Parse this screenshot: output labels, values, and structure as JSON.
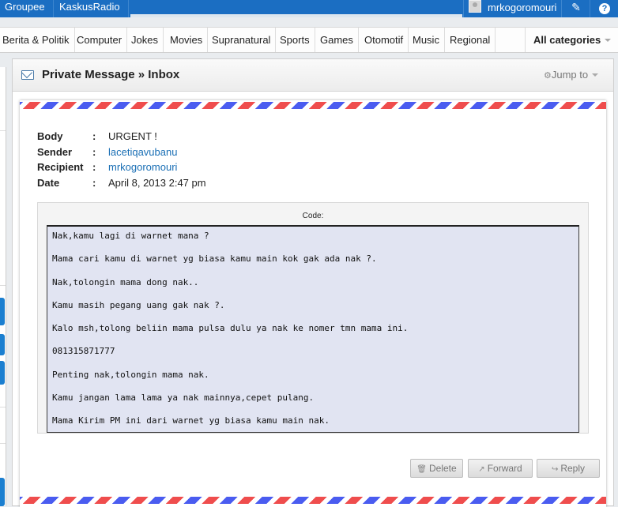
{
  "topbar": {
    "links": [
      "Groupee",
      "KaskusRadio"
    ],
    "username": "mrkogoromouri",
    "edit_icon": "pencil-icon",
    "help_label": "?"
  },
  "categories": {
    "items": [
      "Berita & Politik",
      "Computer",
      "Jokes",
      "Movies",
      "Supranatural",
      "Sports",
      "Games",
      "Otomotif",
      "Music",
      "Regional"
    ],
    "all_label": "All categories"
  },
  "panel": {
    "title": "Private Message » Inbox",
    "jump_label": "Jump to"
  },
  "message": {
    "fields": [
      {
        "label": "Body",
        "value": "URGENT !",
        "is_link": false
      },
      {
        "label": "Sender",
        "value": "lacetiqavubanu",
        "is_link": true
      },
      {
        "label": "Recipient",
        "value": "mrkogoromouri",
        "is_link": true
      },
      {
        "label": "Date",
        "value": "April 8, 2013 2:47 pm",
        "is_link": false
      }
    ],
    "separator": ":",
    "code_label": "Code:",
    "code_lines": [
      "Nak,kamu lagi di warnet mana ?",
      "Mama cari kamu di warnet yg biasa kamu main kok gak ada nak ?.",
      "Nak,tolongin mama dong nak..",
      "Kamu masih pegang uang gak nak ?.",
      "Kalo msh,tolong beliin mama pulsa dulu ya nak ke nomer tmn mama ini.",
      "081315871777",
      "Penting nak,tolongin mama nak.",
      "Kamu jangan lama lama ya nak mainnya,cepet pulang.",
      "Mama Kirim PM ini dari warnet yg biasa kamu main nak."
    ]
  },
  "actions": {
    "delete_label": "Delete",
    "forward_label": "Forward",
    "reply_label": "Reply"
  },
  "colors": {
    "topbar": "#1b6ec2",
    "link": "#1a6fb5",
    "airmail_red": "#ef4d4d",
    "airmail_blue": "#4a5cf0",
    "code_bg": "#e1e4f2"
  }
}
